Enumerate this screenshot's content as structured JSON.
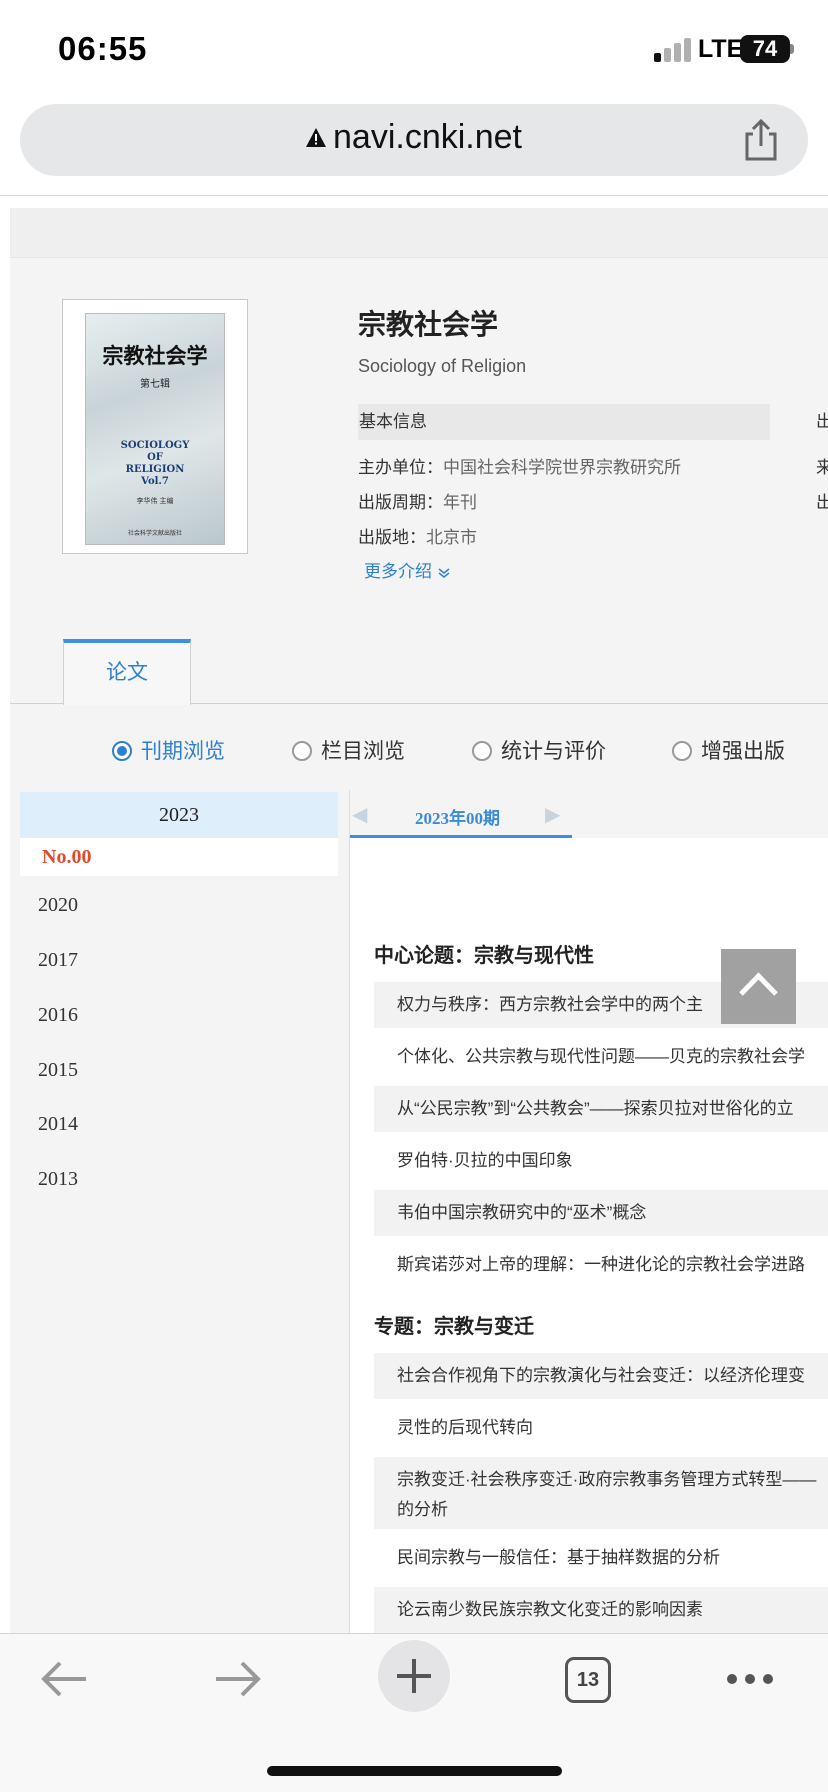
{
  "status": {
    "time": "06:55",
    "network": "LTE",
    "battery": "74"
  },
  "address_bar": {
    "url": "navi.cnki.net"
  },
  "journal": {
    "cover": {
      "title": "宗教社会学",
      "subtitle": "第七辑",
      "english_lines": [
        "SOCIOLOGY",
        "OF",
        "RELIGION",
        "Vol.7"
      ],
      "editor": "李华伟 主编",
      "publisher": "社会科学文献出版社"
    },
    "title": "宗教社会学",
    "english_title": "Sociology of Religion",
    "info_header": "基本信息",
    "info_header_cut": "出",
    "info": [
      {
        "key": "主办单位：",
        "value": "中国社会科学院世界宗教研究所"
      },
      {
        "key": "出版周期：",
        "value": "年刊"
      },
      {
        "key": "出版地：",
        "value": "北京市"
      }
    ],
    "info_cut": [
      "来",
      "出"
    ],
    "more_label": "更多介绍"
  },
  "tabs": {
    "papers": "论文"
  },
  "browse_modes": [
    {
      "label": "刊期浏览",
      "selected": true
    },
    {
      "label": "栏目浏览",
      "selected": false
    },
    {
      "label": "统计与评价",
      "selected": false
    },
    {
      "label": "增强出版",
      "selected": false
    }
  ],
  "years": {
    "current": "2023",
    "current_issue": "No.00",
    "list": [
      "2020",
      "2017",
      "2016",
      "2015",
      "2014",
      "2013"
    ]
  },
  "issue_tab": "2023年00期",
  "sections": [
    {
      "title": "中心论题：宗教与现代性",
      "articles": [
        "权力与秩序：西方宗教社会学中的两个主",
        "个体化、公共宗教与现代性问题——贝克的宗教社会学",
        "从“公民宗教”到“公共教会”——探索贝拉对世俗化的立",
        "罗伯特·贝拉的中国印象",
        "韦伯中国宗教研究中的“巫术”概念",
        "斯宾诺莎对上帝的理解：一种进化论的宗教社会学进路"
      ]
    },
    {
      "title": "专题：宗教与变迁",
      "articles": [
        "社会合作视角下的宗教演化与社会变迁：以经济伦理变",
        "灵性的后现代转向",
        "宗教变迁·社会秩序变迁·政府宗教事务管理方式转型——的分析",
        "民间宗教与一般信任：基于抽样数据的分析",
        "论云南少数民族宗教文化变迁的影响因素"
      ]
    }
  ],
  "toolbar": {
    "tab_count": "13"
  },
  "colors": {
    "accent": "#2d7fd0",
    "issue_red": "#e04b2d",
    "year_highlight": "#deeefb"
  }
}
